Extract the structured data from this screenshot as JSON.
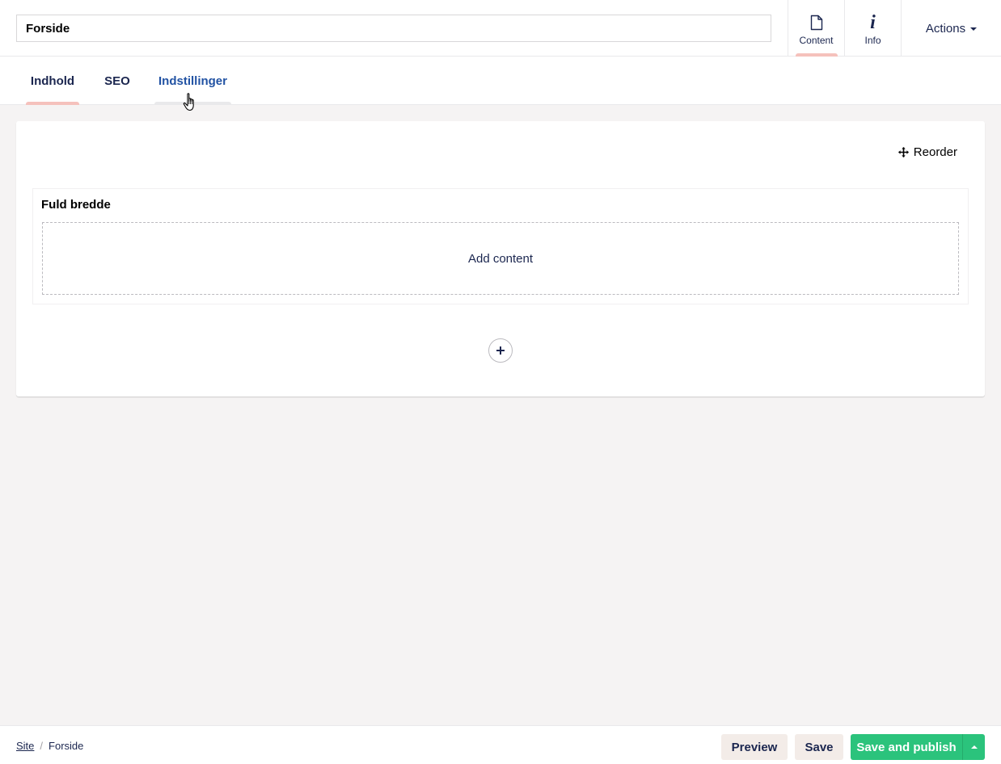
{
  "header": {
    "name_value": "Forside",
    "apps": [
      {
        "label": "Content",
        "icon": "document-icon"
      },
      {
        "label": "Info",
        "icon": "info-icon"
      }
    ],
    "actions_label": "Actions"
  },
  "tabs": [
    {
      "label": "Indhold"
    },
    {
      "label": "SEO"
    },
    {
      "label": "Indstillinger"
    }
  ],
  "panel": {
    "reorder_label": "Reorder",
    "block_title": "Fuld bredde",
    "add_content_label": "Add content"
  },
  "footer": {
    "breadcrumb": [
      {
        "label": "Site"
      },
      {
        "label": "Forside"
      }
    ],
    "breadcrumb_separator": "/",
    "preview_label": "Preview",
    "save_label": "Save",
    "publish_label": "Save and publish"
  },
  "colors": {
    "background": "#f5f3f3",
    "text": "#1b264f",
    "link_blue": "#2152a3",
    "active_indicator": "#f5c1bc",
    "publish_green": "#2bc37c",
    "secondary_button": "#f3ece8"
  }
}
